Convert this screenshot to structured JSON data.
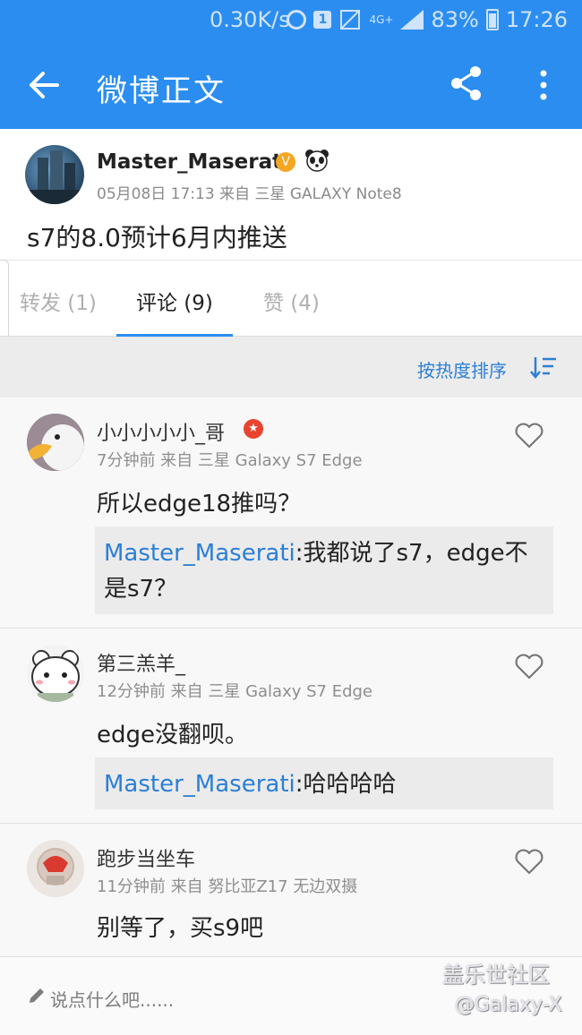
{
  "status_bar": {
    "speed": "0.30K/s",
    "notif_badge": "1",
    "network": "4G+",
    "battery": "83%",
    "time": "17:26"
  },
  "app_bar": {
    "title": "微博正文",
    "icons": [
      "back-arrow-icon",
      "share-icon",
      "more-vertical-icon"
    ]
  },
  "post": {
    "author": "Master_Maserati",
    "verified_badge": "V",
    "meta": "05月08日 17:13 来自 三星 GALAXY Note8",
    "text": "s7的8.0预计6月内推送"
  },
  "tabs": [
    {
      "label": "转发 (1)"
    },
    {
      "label": "评论 (9)"
    },
    {
      "label": "赞 (4)"
    }
  ],
  "sort": {
    "label": "按热度排序"
  },
  "comments": [
    {
      "name": "小小小小小_哥",
      "meta": "7分钟前 来自 三星 Galaxy S7 Edge",
      "text": "所以edge18推吗？",
      "reply_name": "Master_Maserati",
      "reply_text": ":我都说了s7，edge不是s7？"
    },
    {
      "name": "第三羔羊_",
      "meta": "12分钟前 来自 三星 Galaxy S7 Edge",
      "text": "edge没翻呗。",
      "reply_name": "Master_Maserati",
      "reply_text": ":哈哈哈哈"
    },
    {
      "name": "跑步当坐车",
      "meta": "11分钟前 来自 努比亚Z17 无边双摄",
      "text": "别等了，买s9吧"
    }
  ],
  "bottom": {
    "placeholder": "说点什么吧......",
    "watermark_line1": "盖乐世社区",
    "watermark_line2": "@Galaxy-X"
  },
  "colors": {
    "primary": "#2b8df0",
    "link": "#2b7fd6"
  }
}
